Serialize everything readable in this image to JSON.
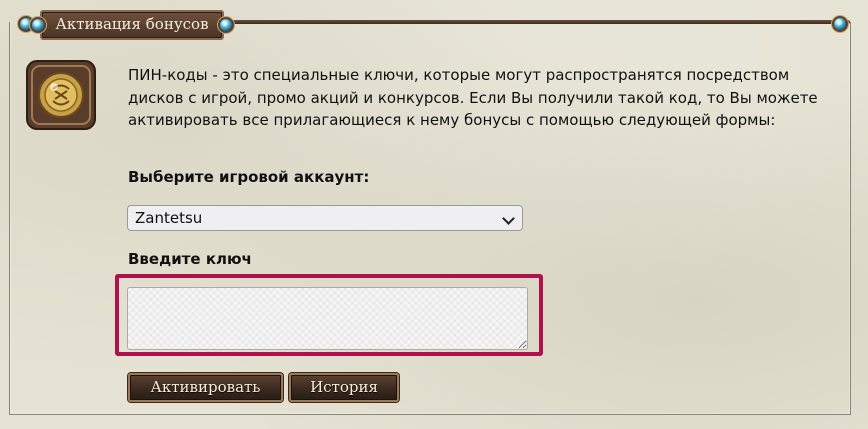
{
  "header": {
    "title": "Активация бонусов"
  },
  "emblem": {
    "icon": "golden-rune-coin-icon"
  },
  "main": {
    "description": "ПИН-коды - это специальные ключи, которые могут распространятся посредством дисков с игрой, промо акций и конкурсов. Если Вы получили такой код, то Вы можете активировать все прилагающиеся к нему бонусы с помощью следующей формы:",
    "account_label": "Выберите игровой аккаунт:",
    "account_select": {
      "selected": "Zantetsu"
    },
    "key_label": "Введите ключ",
    "key_input": {
      "value": "",
      "placeholder": ""
    }
  },
  "buttons": {
    "activate": "Активировать",
    "history": "История"
  },
  "colors": {
    "highlight_frame": "#b0104c",
    "button_bg": "#3b2a1f",
    "button_border": "#9c7a55",
    "title_tab_bg": "#5c4232",
    "gem": "#4fb4d4"
  }
}
